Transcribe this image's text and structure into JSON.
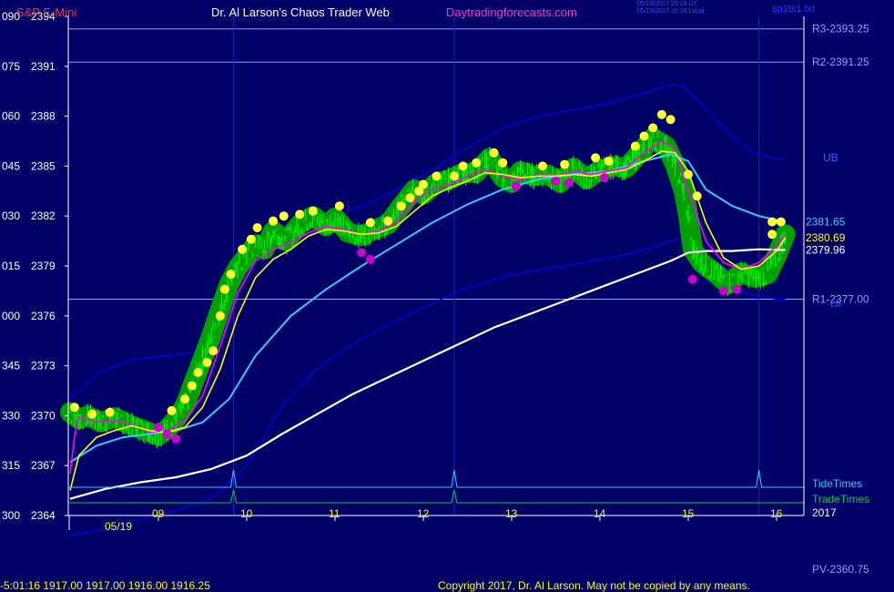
{
  "header": {
    "symbol": "S&P E-Mini",
    "site": "Dr. Al Larson's Chaos Trader Web",
    "url": "Daytradingforecasts.com",
    "time_ut": "05/19/2017 20:19 UT",
    "time_local": "05/19/2017 15:19 Local",
    "file": "sp1ts1.txt"
  },
  "footer": {
    "readout": "-5:01:16  1917.00 1917.00 1916.00 1916.25",
    "copyright": "Copyright 2017, Dr. Al Larson. May not be copied by any means.",
    "pv": "PV-2360.75"
  },
  "colors": {
    "background": "#000066",
    "price": "#00ff00",
    "halo": "#00a000",
    "yellow_line": "#ffff00",
    "magenta_line": "#ff00ff",
    "cyan_line": "#33ccff",
    "white_line": "#ffffff",
    "band_line": "#0000ff",
    "tide": "#33ccff",
    "trade": "#00cc44",
    "vertical_line": "#2222bb",
    "axis_text": "#ffffff",
    "title_red": "#ff3333",
    "title_pink": "#ff33cc"
  },
  "chart_data": {
    "type": "line",
    "y_axis_left": [
      {
        "code": "090",
        "price": 2394
      },
      {
        "code": "075",
        "price": 2391
      },
      {
        "code": "060",
        "price": 2388
      },
      {
        "code": "045",
        "price": 2385
      },
      {
        "code": "030",
        "price": 2382
      },
      {
        "code": "015",
        "price": 2379
      },
      {
        "code": "000",
        "price": 2376
      },
      {
        "code": "345",
        "price": 2373
      },
      {
        "code": "330",
        "price": 2370
      },
      {
        "code": "315",
        "price": 2367
      },
      {
        "code": "300",
        "price": 2364
      }
    ],
    "ylim": [
      2364,
      2394
    ],
    "xlim": [
      8.0,
      16.1
    ],
    "x_ticks": [
      {
        "label": "09",
        "hour": 9
      },
      {
        "label": "10",
        "hour": 10
      },
      {
        "label": "11",
        "hour": 11
      },
      {
        "label": "12",
        "hour": 12
      },
      {
        "label": "13",
        "hour": 13
      },
      {
        "label": "14",
        "hour": 14
      },
      {
        "label": "15",
        "hour": 15
      },
      {
        "label": "16",
        "hour": 16
      }
    ],
    "date_label": "05/19",
    "year_label": "2017",
    "levels": [
      {
        "label": "R3-2393.25",
        "price": 2393.25
      },
      {
        "label": "R2-2391.25",
        "price": 2391.25
      },
      {
        "label": "R1-2377.00",
        "price": 2377.0
      }
    ],
    "band_labels": {
      "upper": "UB",
      "lower": "LB"
    },
    "right_values": [
      {
        "label": "2381.65",
        "price": 2381.65,
        "color": "#33ccff"
      },
      {
        "label": "2380.69",
        "price": 2380.69,
        "color": "#ffff00"
      },
      {
        "label": "2379.96",
        "price": 2379.96,
        "color": "#ffffff"
      }
    ],
    "vertical_lines": [
      9.85,
      12.35,
      15.8
    ],
    "tide_times": {
      "label": "TideTimes",
      "spikes": [
        9.85,
        12.35,
        15.8
      ]
    },
    "trade_times": {
      "label": "TradeTimes",
      "spikes": [
        9.85,
        12.35
      ]
    },
    "series": [
      {
        "key": "price",
        "x": [
          8.0,
          8.1,
          8.2,
          8.35,
          8.5,
          8.65,
          8.8,
          9.0,
          9.1,
          9.2,
          9.3,
          9.4,
          9.5,
          9.6,
          9.7,
          9.8,
          9.9,
          10.0,
          10.1,
          10.2,
          10.3,
          10.45,
          10.6,
          10.75,
          10.9,
          11.0,
          11.15,
          11.3,
          11.45,
          11.6,
          11.75,
          11.9,
          12.0,
          12.15,
          12.3,
          12.45,
          12.6,
          12.75,
          12.9,
          13.0,
          13.1,
          13.25,
          13.4,
          13.55,
          13.7,
          13.85,
          14.0,
          14.15,
          14.3,
          14.45,
          14.6,
          14.75,
          14.85,
          14.95,
          15.0,
          15.05,
          15.15,
          15.3,
          15.45,
          15.6,
          15.75,
          15.9,
          16.0,
          16.1
        ],
        "y": [
          2370.2,
          2369.8,
          2370.0,
          2369.6,
          2369.9,
          2369.5,
          2369.2,
          2368.8,
          2369.2,
          2369.8,
          2370.6,
          2372.0,
          2373.4,
          2374.8,
          2376.4,
          2377.9,
          2378.9,
          2379.6,
          2380.3,
          2380.0,
          2381.1,
          2380.5,
          2381.5,
          2382.0,
          2381.4,
          2381.9,
          2381.0,
          2380.8,
          2381.2,
          2381.5,
          2382.6,
          2383.6,
          2383.3,
          2384.0,
          2384.2,
          2384.6,
          2384.6,
          2385.5,
          2384.3,
          2384.0,
          2384.7,
          2384.4,
          2384.5,
          2384.0,
          2384.9,
          2384.2,
          2384.8,
          2385.0,
          2384.9,
          2385.8,
          2386.7,
          2386.2,
          2385.1,
          2383.5,
          2382.0,
          2380.0,
          2379.2,
          2378.6,
          2377.9,
          2378.6,
          2378.3,
          2378.5,
          2379.6,
          2380.9
        ]
      },
      {
        "key": "yellow",
        "x": [
          8.0,
          8.1,
          8.3,
          8.5,
          8.7,
          8.9,
          9.1,
          9.3,
          9.5,
          9.7,
          9.9,
          10.1,
          10.3,
          10.5,
          10.7,
          10.9,
          11.1,
          11.3,
          11.5,
          11.7,
          11.9,
          12.1,
          12.3,
          12.5,
          12.7,
          12.9,
          13.1,
          13.3,
          13.5,
          13.7,
          13.9,
          14.1,
          14.3,
          14.5,
          14.7,
          14.85,
          15.0,
          15.2,
          15.4,
          15.6,
          15.8,
          16.0,
          16.1
        ],
        "y": [
          2365.5,
          2367.6,
          2368.7,
          2369.1,
          2369.4,
          2369.1,
          2369.0,
          2369.3,
          2370.5,
          2372.8,
          2376.0,
          2378.3,
          2379.4,
          2380.0,
          2380.8,
          2381.2,
          2381.1,
          2380.9,
          2381.0,
          2381.4,
          2382.3,
          2383.2,
          2383.7,
          2384.1,
          2384.6,
          2384.5,
          2384.3,
          2384.4,
          2384.4,
          2384.5,
          2384.4,
          2384.6,
          2384.8,
          2385.3,
          2385.9,
          2385.8,
          2384.7,
          2381.6,
          2379.5,
          2378.8,
          2379.0,
          2379.9,
          2380.69
        ]
      },
      {
        "key": "magenta",
        "x": [
          8.0,
          8.05,
          8.1,
          8.3,
          8.5,
          8.7,
          8.9,
          9.1,
          9.3,
          9.5,
          9.7,
          9.9,
          10.1,
          10.3,
          10.5,
          10.7,
          10.9,
          11.1,
          11.3,
          11.5,
          11.7,
          11.9,
          12.1,
          12.3,
          12.5,
          12.7,
          12.9,
          13.1,
          13.3,
          13.5,
          13.7,
          13.9,
          14.1,
          14.3,
          14.5,
          14.7,
          14.85,
          15.0,
          15.2,
          15.4,
          15.6,
          15.8,
          16.0,
          16.1
        ],
        "y": [
          2366.5,
          2368.8,
          2369.9,
          2369.6,
          2369.7,
          2369.5,
          2369.0,
          2369.1,
          2369.7,
          2371.2,
          2374.2,
          2377.4,
          2379.3,
          2380.0,
          2380.4,
          2381.0,
          2381.4,
          2381.2,
          2380.9,
          2381.1,
          2381.7,
          2382.9,
          2383.6,
          2383.9,
          2384.4,
          2384.8,
          2384.4,
          2384.2,
          2384.5,
          2384.4,
          2384.7,
          2384.5,
          2384.7,
          2384.9,
          2385.8,
          2386.5,
          2386.0,
          2383.5,
          2380.5,
          2379.2,
          2378.8,
          2379.2,
          2380.2,
          2380.9
        ]
      },
      {
        "key": "cyan",
        "x": [
          8.0,
          8.3,
          8.6,
          8.9,
          9.2,
          9.5,
          9.8,
          10.1,
          10.5,
          10.9,
          11.3,
          11.7,
          12.1,
          12.5,
          12.9,
          13.3,
          13.7,
          14.1,
          14.5,
          14.8,
          15.0,
          15.2,
          15.5,
          15.8,
          16.1
        ],
        "y": [
          2367.2,
          2368.2,
          2368.7,
          2368.9,
          2369.1,
          2369.6,
          2371.0,
          2373.6,
          2376.0,
          2377.6,
          2379.0,
          2380.3,
          2381.6,
          2382.7,
          2383.6,
          2384.2,
          2384.5,
          2384.7,
          2385.3,
          2385.7,
          2385.3,
          2383.6,
          2382.6,
          2382.0,
          2381.65
        ]
      },
      {
        "key": "white",
        "x": [
          8.0,
          8.4,
          8.8,
          9.2,
          9.6,
          10.0,
          10.4,
          10.8,
          11.2,
          11.6,
          12.0,
          12.4,
          12.8,
          13.2,
          13.6,
          14.0,
          14.4,
          14.8,
          15.0,
          15.2,
          15.5,
          15.8,
          16.1
        ],
        "y": [
          2365.0,
          2365.6,
          2366.0,
          2366.3,
          2366.8,
          2367.6,
          2368.9,
          2370.1,
          2371.3,
          2372.3,
          2373.3,
          2374.3,
          2375.3,
          2376.1,
          2376.9,
          2377.7,
          2378.5,
          2379.3,
          2379.8,
          2379.9,
          2379.9,
          2380.0,
          2379.96
        ]
      },
      {
        "key": "upper_band",
        "x": [
          8.0,
          8.3,
          8.7,
          9.1,
          9.5,
          9.8,
          10.1,
          10.5,
          10.9,
          11.3,
          11.7,
          12.1,
          12.5,
          12.9,
          13.3,
          13.7,
          14.1,
          14.5,
          14.8,
          14.95,
          15.1,
          15.4,
          15.7,
          16.0,
          16.1
        ],
        "y": [
          2371.0,
          2372.5,
          2373.4,
          2373.6,
          2373.9,
          2376.5,
          2380.0,
          2381.2,
          2382.0,
          2382.6,
          2383.6,
          2384.8,
          2386.1,
          2387.3,
          2388.0,
          2388.4,
          2388.8,
          2389.4,
          2389.9,
          2389.8,
          2389.0,
          2387.3,
          2385.9,
          2385.4,
          2385.4
        ]
      },
      {
        "key": "lower_band",
        "x": [
          8.0,
          8.4,
          8.8,
          9.2,
          9.6,
          10.0,
          10.4,
          10.8,
          11.2,
          11.6,
          12.0,
          12.4,
          12.8,
          13.2,
          13.6,
          14.0,
          14.4,
          14.8,
          15.0,
          15.3,
          15.6,
          16.0,
          16.1
        ],
        "y": [
          2362.8,
          2363.2,
          2363.8,
          2364.3,
          2365.0,
          2367.0,
          2370.6,
          2372.9,
          2374.3,
          2375.5,
          2376.5,
          2377.5,
          2378.2,
          2378.7,
          2379.0,
          2379.4,
          2379.8,
          2380.5,
          2380.8,
          2378.7,
          2377.4,
          2377.0,
          2377.0
        ]
      }
    ],
    "yellow_dots": [
      [
        8.05,
        2370.5
      ],
      [
        8.25,
        2370.1
      ],
      [
        8.45,
        2370.2
      ],
      [
        9.15,
        2370.3
      ],
      [
        9.3,
        2371.0
      ],
      [
        9.38,
        2371.8
      ],
      [
        9.45,
        2372.6
      ],
      [
        9.55,
        2373.2
      ],
      [
        9.62,
        2373.9
      ],
      [
        9.7,
        2376.0
      ],
      [
        9.75,
        2377.6
      ],
      [
        9.82,
        2378.5
      ],
      [
        9.95,
        2380.0
      ],
      [
        10.05,
        2380.6
      ],
      [
        10.12,
        2381.3
      ],
      [
        10.3,
        2381.7
      ],
      [
        10.42,
        2382.0
      ],
      [
        10.6,
        2382.1
      ],
      [
        10.75,
        2382.3
      ],
      [
        11.05,
        2382.6
      ],
      [
        11.4,
        2381.6
      ],
      [
        11.6,
        2381.7
      ],
      [
        11.75,
        2382.6
      ],
      [
        11.85,
        2383.1
      ],
      [
        11.95,
        2383.5
      ],
      [
        12.0,
        2383.9
      ],
      [
        12.15,
        2384.4
      ],
      [
        12.35,
        2384.4
      ],
      [
        12.45,
        2385.0
      ],
      [
        12.6,
        2385.2
      ],
      [
        12.8,
        2385.8
      ],
      [
        12.9,
        2385.2
      ],
      [
        13.35,
        2385.0
      ],
      [
        13.6,
        2385.1
      ],
      [
        13.95,
        2385.5
      ],
      [
        14.1,
        2385.3
      ],
      [
        14.4,
        2386.2
      ],
      [
        14.5,
        2386.8
      ],
      [
        14.6,
        2387.3
      ],
      [
        14.7,
        2388.1
      ],
      [
        14.8,
        2387.8
      ],
      [
        15.0,
        2384.5
      ],
      [
        15.1,
        2383.2
      ],
      [
        15.95,
        2381.65
      ],
      [
        16.05,
        2381.65
      ],
      [
        15.95,
        2380.9
      ]
    ],
    "magenta_dots": [
      [
        9.0,
        2369.3
      ],
      [
        9.1,
        2368.9
      ],
      [
        9.2,
        2368.6
      ],
      [
        11.3,
        2379.8
      ],
      [
        11.4,
        2379.4
      ],
      [
        13.05,
        2383.8
      ],
      [
        13.5,
        2384.1
      ],
      [
        13.65,
        2384.0
      ],
      [
        14.05,
        2384.3
      ],
      [
        15.05,
        2378.2
      ],
      [
        15.4,
        2377.5
      ],
      [
        15.55,
        2377.6
      ]
    ]
  }
}
